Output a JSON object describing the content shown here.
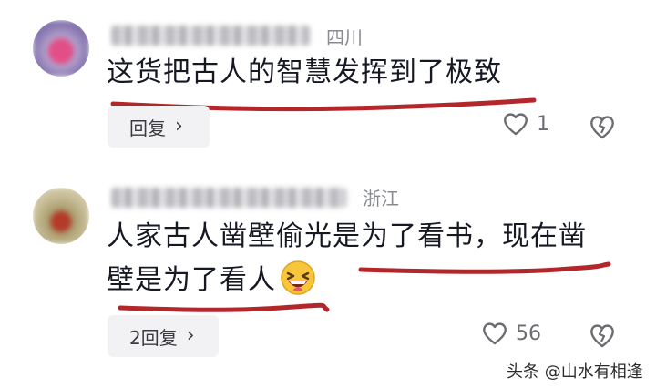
{
  "comments": [
    {
      "region": "四川",
      "text": "这货把古人的智慧发挥到了极致",
      "reply_label": "回复",
      "like_count": "1"
    },
    {
      "region": "浙江",
      "text_line1": "人家古人凿壁偷光是为了看书，现在凿",
      "text_line2": "壁是为了看人",
      "reply_label": "2回复",
      "like_count": "56"
    }
  ],
  "icons": {
    "chevron": "chevron-right-icon",
    "like": "heart-outline-icon",
    "dislike": "broken-heart-icon",
    "emoji": "laughing-emoji-icon"
  },
  "colors": {
    "underline": "#b3262a",
    "secondary_text": "#8a8b91",
    "button_bg": "#f2f2f4"
  },
  "watermark": "头条 @山水有相逢"
}
